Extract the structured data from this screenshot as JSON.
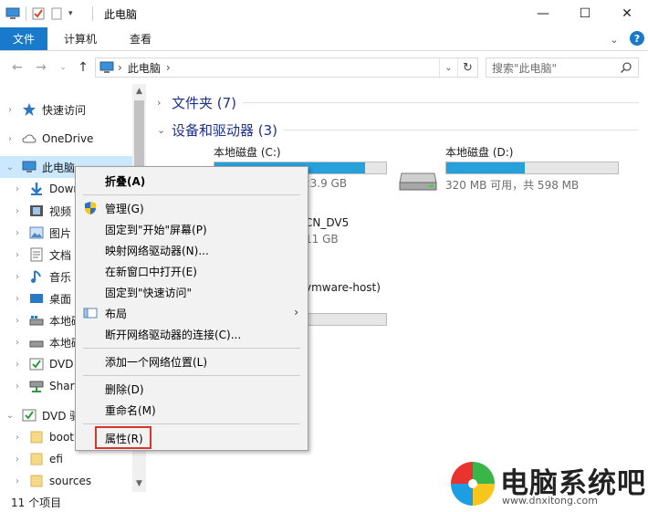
{
  "window": {
    "title": "此电脑",
    "controls": [
      "minimize-icon",
      "maximize-icon",
      "close-icon"
    ]
  },
  "ribbon": {
    "tabs": [
      {
        "label": "文件",
        "active": true
      },
      {
        "label": "计算机",
        "active": false
      },
      {
        "label": "查看",
        "active": false
      }
    ],
    "help_label": "?"
  },
  "address": {
    "crumbs": [
      "此电脑"
    ],
    "search_placeholder": "搜索\"此电脑\""
  },
  "nav": {
    "items": [
      {
        "label": "快速访问",
        "icon": "star-icon"
      },
      {
        "label": "OneDrive",
        "icon": "cloud-icon"
      },
      {
        "label": "此电脑",
        "icon": "computer-icon",
        "selected": true
      },
      {
        "label": "Down",
        "icon": "download-icon"
      },
      {
        "label": "视频",
        "icon": "video-icon"
      },
      {
        "label": "图片",
        "icon": "picture-icon"
      },
      {
        "label": "文档",
        "icon": "document-icon"
      },
      {
        "label": "音乐",
        "icon": "music-icon"
      },
      {
        "label": "桌面",
        "icon": "desktop-icon"
      },
      {
        "label": "本地磁",
        "icon": "drive-icon"
      },
      {
        "label": "本地磁",
        "icon": "drive-icon"
      },
      {
        "label": "DVD",
        "icon": "dvd-icon"
      },
      {
        "label": "Share",
        "icon": "network-drive-icon"
      },
      {
        "label": "DVD 驱",
        "icon": "dvd-icon"
      },
      {
        "label": "boot",
        "icon": "folder-icon"
      },
      {
        "label": "efi",
        "icon": "folder-icon"
      },
      {
        "label": "sources",
        "icon": "folder-icon"
      }
    ]
  },
  "content": {
    "groups": [
      {
        "label": "文件夹 (7)"
      },
      {
        "label": "设备和驱动器 (3)"
      }
    ],
    "drives": [
      {
        "name": "本地磁盘 (C:)",
        "fill": 0.88,
        "sub": "23.9 GB"
      },
      {
        "name": "本地磁盘 (D:)",
        "fill": 0.46,
        "sub": "320 MB 可用，共 598 MB"
      },
      {
        "name": "CN_DV5",
        "sub": "11 GB"
      },
      {
        "name": "vmware-host)",
        "fill": 0.0
      }
    ]
  },
  "menu": {
    "items": [
      {
        "label": "折叠(A)",
        "bold": true
      },
      {
        "label": "管理(G)",
        "icon": "shield-icon"
      },
      {
        "label": "固定到\"开始\"屏幕(P)"
      },
      {
        "label": "映射网络驱动器(N)..."
      },
      {
        "label": "在新窗口中打开(E)"
      },
      {
        "label": "固定到\"快速访问\""
      },
      {
        "label": "布局",
        "icon": "layout-icon",
        "submenu": true
      },
      {
        "label": "断开网络驱动器的连接(C)..."
      },
      {
        "label": "添加一个网络位置(L)"
      },
      {
        "label": "删除(D)"
      },
      {
        "label": "重命名(M)"
      },
      {
        "label": "属性(R)",
        "highlighted": true
      }
    ]
  },
  "status": {
    "items_count": "11 个项目"
  },
  "watermark": {
    "name": "电脑系统吧",
    "url": "www.dnxitong.com"
  },
  "colors": {
    "accent": "#1979ca",
    "bar_fill": "#26a0da",
    "selection": "#cce8ff",
    "highlight_box": "#d9362b"
  }
}
